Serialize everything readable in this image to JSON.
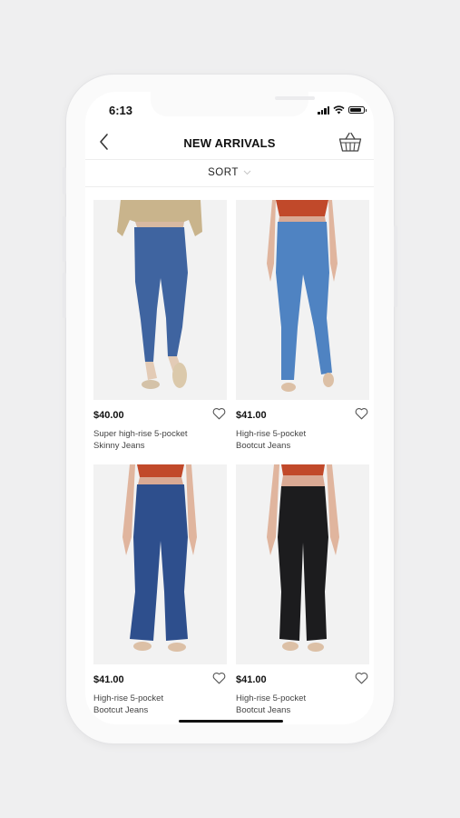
{
  "status_bar": {
    "time": "6:13",
    "battery_level": 0.85
  },
  "header": {
    "title": "NEW ARRIVALS",
    "back_icon": "chevron-left-icon",
    "basket_icon": "basket-icon"
  },
  "sort": {
    "label": "SORT",
    "icon": "chevron-down-icon"
  },
  "products": [
    {
      "price": "$40.00",
      "name_line1": "Super high-rise 5-pocket",
      "name_line2": "Skinny Jeans",
      "top_color": "#c9b48c",
      "jeans_color": "#3f64a0",
      "wishlist_icon": "heart-outline-icon"
    },
    {
      "price": "$41.00",
      "name_line1": "High-rise 5-pocket",
      "name_line2": "Bootcut Jeans",
      "top_color": "#c1492a",
      "jeans_color": "#4f83c2",
      "wishlist_icon": "heart-outline-icon"
    },
    {
      "price": "$41.00",
      "name_line1": "High-rise 5-pocket",
      "name_line2": "Bootcut Jeans",
      "top_color": "#c1492a",
      "jeans_color": "#2e4f8d",
      "wishlist_icon": "heart-outline-icon"
    },
    {
      "price": "$41.00",
      "name_line1": "High-rise 5-pocket",
      "name_line2": "Bootcut Jeans",
      "top_color": "#c1492a",
      "jeans_color": "#1c1c1e",
      "wishlist_icon": "heart-outline-icon"
    }
  ]
}
